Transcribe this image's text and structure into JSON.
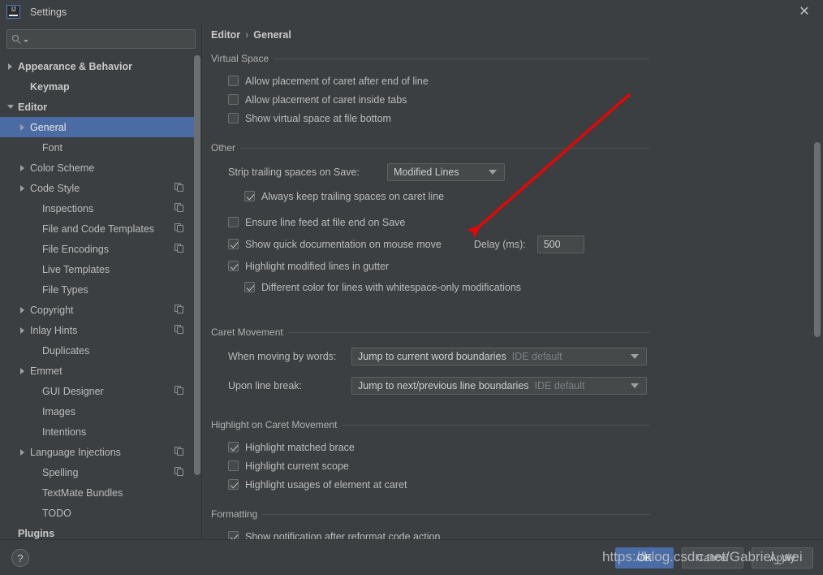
{
  "window": {
    "title": "Settings",
    "logo_text": "IJ",
    "close_label": "✕"
  },
  "sidebar": {
    "search": {
      "value": "",
      "placeholder": ""
    },
    "items": [
      {
        "label": "Appearance & Behavior",
        "indent": 0,
        "arrow": "right",
        "bold": true,
        "selected": false,
        "copy": false
      },
      {
        "label": "Keymap",
        "indent": 1,
        "arrow": "none",
        "bold": true,
        "selected": false,
        "copy": false
      },
      {
        "label": "Editor",
        "indent": 0,
        "arrow": "down",
        "bold": true,
        "selected": false,
        "copy": false
      },
      {
        "label": "General",
        "indent": 1,
        "arrow": "right",
        "bold": false,
        "selected": true,
        "copy": false
      },
      {
        "label": "Font",
        "indent": 2,
        "arrow": "none",
        "bold": false,
        "selected": false,
        "copy": false
      },
      {
        "label": "Color Scheme",
        "indent": 1,
        "arrow": "right",
        "bold": false,
        "selected": false,
        "copy": false
      },
      {
        "label": "Code Style",
        "indent": 1,
        "arrow": "right",
        "bold": false,
        "selected": false,
        "copy": true
      },
      {
        "label": "Inspections",
        "indent": 2,
        "arrow": "none",
        "bold": false,
        "selected": false,
        "copy": true
      },
      {
        "label": "File and Code Templates",
        "indent": 2,
        "arrow": "none",
        "bold": false,
        "selected": false,
        "copy": true
      },
      {
        "label": "File Encodings",
        "indent": 2,
        "arrow": "none",
        "bold": false,
        "selected": false,
        "copy": true
      },
      {
        "label": "Live Templates",
        "indent": 2,
        "arrow": "none",
        "bold": false,
        "selected": false,
        "copy": false
      },
      {
        "label": "File Types",
        "indent": 2,
        "arrow": "none",
        "bold": false,
        "selected": false,
        "copy": false
      },
      {
        "label": "Copyright",
        "indent": 1,
        "arrow": "right",
        "bold": false,
        "selected": false,
        "copy": true
      },
      {
        "label": "Inlay Hints",
        "indent": 1,
        "arrow": "right",
        "bold": false,
        "selected": false,
        "copy": true
      },
      {
        "label": "Duplicates",
        "indent": 2,
        "arrow": "none",
        "bold": false,
        "selected": false,
        "copy": false
      },
      {
        "label": "Emmet",
        "indent": 1,
        "arrow": "right",
        "bold": false,
        "selected": false,
        "copy": false
      },
      {
        "label": "GUI Designer",
        "indent": 2,
        "arrow": "none",
        "bold": false,
        "selected": false,
        "copy": true
      },
      {
        "label": "Images",
        "indent": 2,
        "arrow": "none",
        "bold": false,
        "selected": false,
        "copy": false
      },
      {
        "label": "Intentions",
        "indent": 2,
        "arrow": "none",
        "bold": false,
        "selected": false,
        "copy": false
      },
      {
        "label": "Language Injections",
        "indent": 1,
        "arrow": "right",
        "bold": false,
        "selected": false,
        "copy": true
      },
      {
        "label": "Spelling",
        "indent": 2,
        "arrow": "none",
        "bold": false,
        "selected": false,
        "copy": true
      },
      {
        "label": "TextMate Bundles",
        "indent": 2,
        "arrow": "none",
        "bold": false,
        "selected": false,
        "copy": false
      },
      {
        "label": "TODO",
        "indent": 2,
        "arrow": "none",
        "bold": false,
        "selected": false,
        "copy": false
      },
      {
        "label": "Plugins",
        "indent": 0,
        "arrow": "none",
        "bold": true,
        "selected": false,
        "copy": false
      }
    ]
  },
  "breadcrumb": {
    "parent": "Editor",
    "separator": "›",
    "current": "General"
  },
  "sections": {
    "virtual_space": {
      "title": "Virtual Space",
      "checkboxes": [
        {
          "label": "Allow placement of caret after end of line",
          "checked": false
        },
        {
          "label": "Allow placement of caret inside tabs",
          "checked": false
        },
        {
          "label": "Show virtual space at file bottom",
          "checked": false
        }
      ]
    },
    "other": {
      "title": "Other",
      "strip_label": "Strip trailing spaces on Save:",
      "strip_value": "Modified Lines",
      "always_keep": {
        "label": "Always keep trailing spaces on caret line",
        "checked": true
      },
      "ensure_lf": {
        "label": "Ensure line feed at file end on Save",
        "checked": false
      },
      "quick_doc": {
        "label": "Show quick documentation on mouse move",
        "checked": true
      },
      "delay_label": "Delay (ms):",
      "delay_value": "500",
      "highlight_modified": {
        "label": "Highlight modified lines in gutter",
        "checked": true
      },
      "different_color": {
        "label": "Different color for lines with whitespace-only modifications",
        "checked": true
      }
    },
    "caret_movement": {
      "title": "Caret Movement",
      "when_moving_label": "When moving by words:",
      "when_moving_value": "Jump to current word boundaries",
      "when_moving_hint": "IDE default",
      "upon_break_label": "Upon line break:",
      "upon_break_value": "Jump to next/previous line boundaries",
      "upon_break_hint": "IDE default"
    },
    "highlight_caret": {
      "title": "Highlight on Caret Movement",
      "checkboxes": [
        {
          "label": "Highlight matched brace",
          "checked": true
        },
        {
          "label": "Highlight current scope",
          "checked": false
        },
        {
          "label": "Highlight usages of element at caret",
          "checked": true
        }
      ]
    },
    "formatting": {
      "title": "Formatting",
      "checkboxes": [
        {
          "label": "Show notification after reformat code action",
          "checked": true
        }
      ]
    }
  },
  "footer": {
    "help_label": "?",
    "ok_label": "OK",
    "cancel_label": "Cancel",
    "apply_label": "Apply"
  },
  "annotations": {
    "watermark_text": "https://blog.csdn.net/Gabriel_wei",
    "arrow_color": "#f40000"
  },
  "colors": {
    "background": "#3c3f41",
    "selection": "#4b6ba5",
    "primary_button": "#4a6da7",
    "text": "#bbbbbb"
  }
}
